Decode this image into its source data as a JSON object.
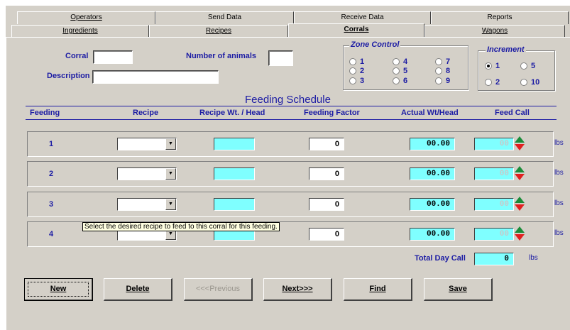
{
  "tabs_row1": [
    {
      "label": "Operators",
      "u": "O"
    },
    {
      "label": "Send Data",
      "u": ""
    },
    {
      "label": "Receive Data",
      "u": ""
    },
    {
      "label": "Reports",
      "u": ""
    }
  ],
  "tabs_row2": [
    {
      "label": "Ingredients",
      "u": "I"
    },
    {
      "label": "Recipes",
      "u": "R"
    },
    {
      "label": "Corrals",
      "u": "C",
      "active": true
    },
    {
      "label": "Wagons",
      "u": "W"
    }
  ],
  "form": {
    "corral_label": "Corral",
    "corral_value": "",
    "animals_label": "Number of animals",
    "animals_value": "",
    "description_label": "Description",
    "description_value": ""
  },
  "zone_control": {
    "title": "Zone Control",
    "options": [
      "1",
      "4",
      "7",
      "2",
      "5",
      "8",
      "3",
      "6",
      "9"
    ]
  },
  "increment": {
    "title": "Increment",
    "options": [
      "1",
      "5",
      "2",
      "10"
    ],
    "selected": "1"
  },
  "schedule": {
    "title": "Feeding Schedule",
    "headers": {
      "feeding": "Feeding",
      "recipe": "Recipe",
      "recipe_wt": "Recipe Wt. / Head",
      "factor": "Feeding Factor",
      "actual": "Actual Wt/Head",
      "feed_call": "Feed Call"
    },
    "rows": [
      {
        "num": "1",
        "factor": "0",
        "actual": "00.00",
        "call": "00",
        "unit": "lbs"
      },
      {
        "num": "2",
        "factor": "0",
        "actual": "00.00",
        "call": "00",
        "unit": "lbs"
      },
      {
        "num": "3",
        "factor": "0",
        "actual": "00.00",
        "call": "00",
        "unit": "lbs"
      },
      {
        "num": "4",
        "factor": "0",
        "actual": "00.00",
        "call": "00",
        "unit": "lbs"
      }
    ],
    "total_label": "Total Day Call",
    "total_value": "0",
    "total_unit": "lbs"
  },
  "tooltip": "Select the desired recipe to feed to this corral for this feeding.",
  "buttons": {
    "new": "New",
    "delete": "Delete",
    "previous": "<<<Previous",
    "next": "Next>>>",
    "find": "Find",
    "save": "Save"
  },
  "colors": {
    "label_blue": "#1c1ca4",
    "cyan_field": "#7fffff",
    "panel_gray": "#d4d0c8"
  }
}
